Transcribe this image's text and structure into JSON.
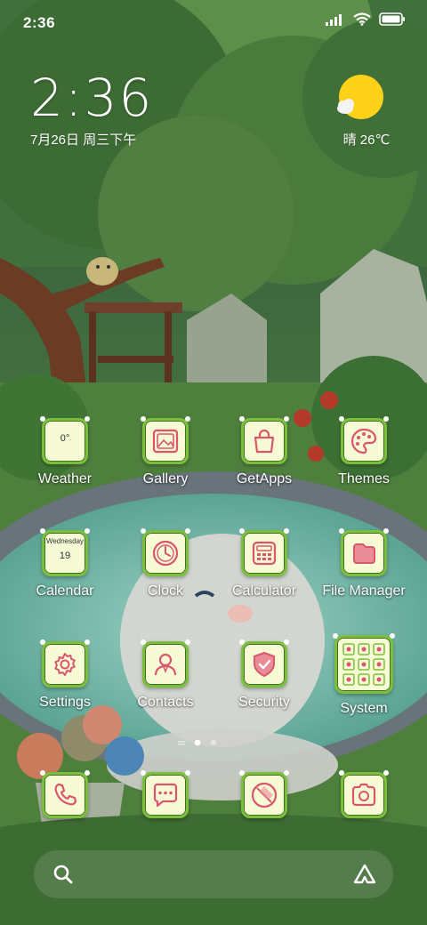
{
  "status_bar": {
    "time": "2:36",
    "signal_icon": "signal-bars-icon",
    "wifi_icon": "wifi-icon",
    "battery_icon": "battery-icon"
  },
  "clock_widget": {
    "time": "2:36",
    "date": "7月26日 周三下午"
  },
  "weather_widget": {
    "icon": "sun-cloud-icon",
    "temperature": "晴 26℃"
  },
  "apps": [
    {
      "label": "Weather",
      "icon": "weather-icon",
      "tile_text": "0°"
    },
    {
      "label": "Gallery",
      "icon": "gallery-icon"
    },
    {
      "label": "GetApps",
      "icon": "shopping-bag-icon"
    },
    {
      "label": "Themes",
      "icon": "palette-icon"
    },
    {
      "label": "Calendar",
      "icon": "calendar-icon",
      "tile_weekday": "Wednesday",
      "tile_day": "19"
    },
    {
      "label": "Clock",
      "icon": "clock-icon"
    },
    {
      "label": "Calculator",
      "icon": "calculator-icon"
    },
    {
      "label": "File Manager",
      "icon": "folder-icon"
    },
    {
      "label": "Settings",
      "icon": "gear-icon"
    },
    {
      "label": "Contacts",
      "icon": "person-icon"
    },
    {
      "label": "Security",
      "icon": "shield-check-icon"
    },
    {
      "label": "System",
      "icon": "app-folder-icon"
    }
  ],
  "dock": [
    {
      "icon": "phone-icon"
    },
    {
      "icon": "message-icon"
    },
    {
      "icon": "browser-icon"
    },
    {
      "icon": "camera-icon"
    }
  ],
  "page_indicator": {
    "total": 3,
    "current": 2
  },
  "search_bar": {
    "search_icon": "search-icon",
    "assistant_icon": "assistant-icon"
  },
  "colors": {
    "tile_bg": "#f6fbd6",
    "tile_border": "#7cbf3c",
    "icon_stroke": "#d9566c"
  }
}
